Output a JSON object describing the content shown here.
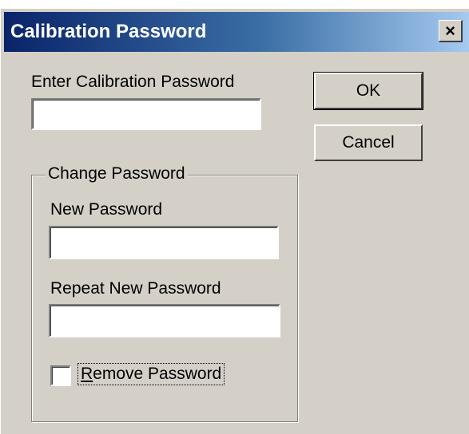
{
  "dialog": {
    "title": "Calibration Password",
    "close_symbol": "×",
    "close_icon": "close-icon"
  },
  "password": {
    "label": "Enter Calibration Password",
    "value": ""
  },
  "buttons": {
    "ok_label": "OK",
    "cancel_label": "Cancel"
  },
  "change_group": {
    "legend": "Change Password",
    "new_label": "New Password",
    "new_value": "",
    "repeat_label": "Repeat New Password",
    "repeat_value": "",
    "remove_first": "R",
    "remove_rest": "emove Password",
    "remove_checked": false
  },
  "colors": {
    "face": "#d4d0c8",
    "title_start": "#0a246a",
    "title_end": "#a6caf0"
  }
}
